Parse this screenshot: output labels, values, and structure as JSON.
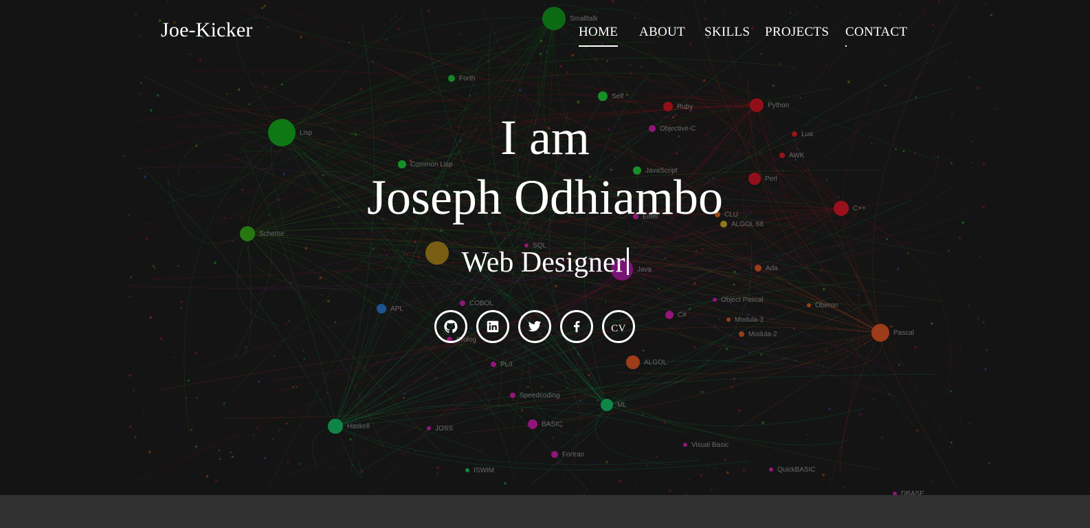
{
  "brand": "Joe-Kicker",
  "nav": {
    "items": [
      {
        "label": "HOME",
        "active": true
      },
      {
        "label": "ABOUT",
        "active": false
      },
      {
        "label": "SKILLS",
        "active": false
      },
      {
        "label": "PROJECTS",
        "active": false
      },
      {
        "label": "CONTACT",
        "active": false
      }
    ]
  },
  "hero": {
    "line1": "I am",
    "line2": "Joseph Odhiambo",
    "typed_role": "Web Designer"
  },
  "socials": {
    "items": [
      {
        "icon": "github-icon"
      },
      {
        "icon": "linkedin-icon"
      },
      {
        "icon": "twitter-icon"
      },
      {
        "icon": "facebook-icon"
      },
      {
        "icon": "cv-icon",
        "label": "CV"
      }
    ]
  },
  "background_graph": {
    "nodes": [
      {
        "label": "Smalltalk",
        "color": "#0c7a14"
      },
      {
        "label": "Forth",
        "color": "#169c2a"
      },
      {
        "label": "Self",
        "color": "#17a52c"
      },
      {
        "label": "Lisp",
        "color": "#0d8a16"
      },
      {
        "label": "Common Lisp",
        "color": "#17a52c"
      },
      {
        "label": "Scheme",
        "color": "#2b8a12"
      },
      {
        "label": "Ruby",
        "color": "#a80f1c"
      },
      {
        "label": "Python",
        "color": "#a80f1c"
      },
      {
        "label": "Objective-C",
        "color": "#a8178c"
      },
      {
        "label": "Lua",
        "color": "#b0141c"
      },
      {
        "label": "AWK",
        "color": "#b0141c"
      },
      {
        "label": "JavaScript",
        "color": "#17a52c"
      },
      {
        "label": "Perl",
        "color": "#a80f1c"
      },
      {
        "label": "C++",
        "color": "#b0101e"
      },
      {
        "label": "CLU",
        "color": "#b6531a"
      },
      {
        "label": "Eiffel",
        "color": "#a8178c"
      },
      {
        "label": "ALGOL 68",
        "color": "#a88a1a"
      },
      {
        "label": "SQL",
        "color": "#a8178c"
      },
      {
        "label": "Java",
        "color": "#8a1484"
      },
      {
        "label": "Ada",
        "color": "#b6431a"
      },
      {
        "label": "APL",
        "color": "#1f5fa8"
      },
      {
        "label": "COBOL",
        "color": "#a8178c"
      },
      {
        "label": "Object Pascal",
        "color": "#a8178c"
      },
      {
        "label": "Oberon",
        "color": "#b6431a"
      },
      {
        "label": "C#",
        "color": "#a8178c"
      },
      {
        "label": "Modula-3",
        "color": "#b6431a"
      },
      {
        "label": "Modula-2",
        "color": "#b6431a"
      },
      {
        "label": "Pascal",
        "color": "#b6431a"
      },
      {
        "label": "Prolog",
        "color": "#a8178c"
      },
      {
        "label": "ALGOL",
        "color": "#b6431a"
      },
      {
        "label": "PL/I",
        "color": "#a8178c"
      },
      {
        "label": "Speedcoding",
        "color": "#a8178c"
      },
      {
        "label": "ML",
        "color": "#0f9a52"
      },
      {
        "label": "Haskell",
        "color": "#0f9a52"
      },
      {
        "label": "JOSS",
        "color": "#a8178c"
      },
      {
        "label": "BASIC",
        "color": "#a8178c"
      },
      {
        "label": "Visual Basic",
        "color": "#a8178c"
      },
      {
        "label": "Fortran",
        "color": "#a8178c"
      },
      {
        "label": "QuickBASIC",
        "color": "#a8178c"
      },
      {
        "label": "ISWIM",
        "color": "#0f9a52"
      },
      {
        "label": "DBASE",
        "color": "#a8178c"
      }
    ]
  }
}
